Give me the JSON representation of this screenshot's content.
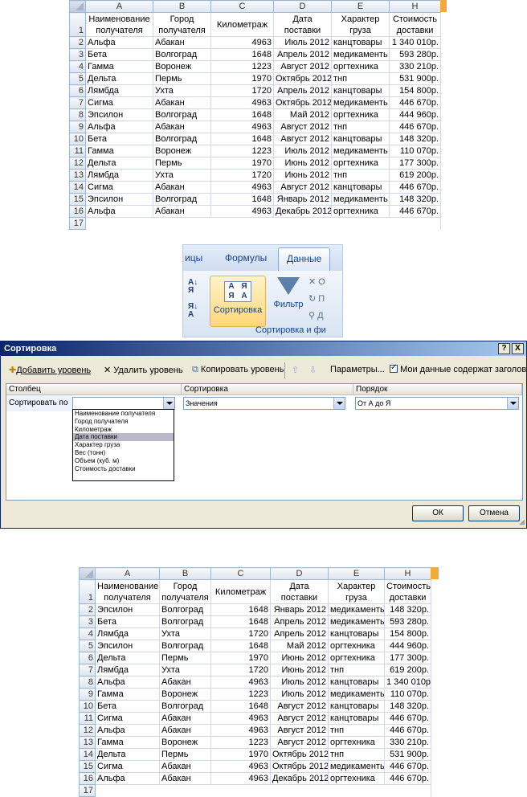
{
  "col_letters": [
    "A",
    "B",
    "C",
    "D",
    "E",
    "H"
  ],
  "headers": [
    "Наименование получателя",
    "Город получателя",
    "Километраж",
    "Дата поставки",
    "Характер груза",
    "Стоимость доставки"
  ],
  "table1": {
    "rows": [
      [
        "2",
        "Альфа",
        "Абакан",
        "4963",
        "Июль 2012",
        "канцтовары",
        "1 340 010р."
      ],
      [
        "3",
        "Бета",
        "Волгоград",
        "1648",
        "Апрель 2012",
        "медикаменть",
        "593 280р."
      ],
      [
        "4",
        "Гамма",
        "Воронеж",
        "1223",
        "Август 2012",
        "оргтехника",
        "330 210р."
      ],
      [
        "5",
        "Дельта",
        "Пермь",
        "1970",
        "Октябрь 2012",
        "тнп",
        "531 900р."
      ],
      [
        "6",
        "Лямбда",
        "Ухта",
        "1720",
        "Апрель 2012",
        "канцтовары",
        "154 800р."
      ],
      [
        "7",
        "Сигма",
        "Абакан",
        "4963",
        "Октябрь 2012",
        "медикаменть",
        "446 670р."
      ],
      [
        "8",
        "Эпсилон",
        "Волгоград",
        "1648",
        "Май 2012",
        "оргтехника",
        "444 960р."
      ],
      [
        "9",
        "Альфа",
        "Абакан",
        "4963",
        "Август 2012",
        "тнп",
        "446 670р."
      ],
      [
        "10",
        "Бета",
        "Волгоград",
        "1648",
        "Август 2012",
        "канцтовары",
        "148 320р."
      ],
      [
        "11",
        "Гамма",
        "Воронеж",
        "1223",
        "Июль 2012",
        "медикаменть",
        "110 070р."
      ],
      [
        "12",
        "Дельта",
        "Пермь",
        "1970",
        "Июнь 2012",
        "оргтехника",
        "177 300р."
      ],
      [
        "13",
        "Лямбда",
        "Ухта",
        "1720",
        "Июнь 2012",
        "тнп",
        "619 200р."
      ],
      [
        "14",
        "Сигма",
        "Абакан",
        "4963",
        "Август 2012",
        "канцтовары",
        "446 670р."
      ],
      [
        "15",
        "Эпсилон",
        "Волгоград",
        "1648",
        "Январь 2012",
        "медикаменть",
        "148 320р."
      ],
      [
        "16",
        "Альфа",
        "Абакан",
        "4963",
        "Декабрь 2012",
        "оргтехника",
        "446 670р."
      ]
    ]
  },
  "table2": {
    "rows": [
      [
        "2",
        "Эпсилон",
        "Волгоград",
        "1648",
        "Январь 2012",
        "медикаменть",
        "148 320р."
      ],
      [
        "3",
        "Бета",
        "Волгоград",
        "1648",
        "Апрель 2012",
        "медикаменть",
        "593 280р."
      ],
      [
        "4",
        "Лямбда",
        "Ухта",
        "1720",
        "Апрель 2012",
        "канцтовары",
        "154 800р."
      ],
      [
        "5",
        "Эпсилон",
        "Волгоград",
        "1648",
        "Май 2012",
        "оргтехника",
        "444 960р."
      ],
      [
        "6",
        "Дельта",
        "Пермь",
        "1970",
        "Июнь 2012",
        "оргтехника",
        "177 300р."
      ],
      [
        "7",
        "Лямбда",
        "Ухта",
        "1720",
        "Июнь 2012",
        "тнп",
        "619 200р."
      ],
      [
        "8",
        "Альфа",
        "Абакан",
        "4963",
        "Июль 2012",
        "канцтовары",
        "1 340 010р."
      ],
      [
        "9",
        "Гамма",
        "Воронеж",
        "1223",
        "Июль 2012",
        "медикаменть",
        "110 070р."
      ],
      [
        "10",
        "Бета",
        "Волгоград",
        "1648",
        "Август 2012",
        "канцтовары",
        "148 320р."
      ],
      [
        "11",
        "Сигма",
        "Абакан",
        "4963",
        "Август 2012",
        "канцтовары",
        "446 670р."
      ],
      [
        "12",
        "Альфа",
        "Абакан",
        "4963",
        "Август 2012",
        "тнп",
        "446 670р."
      ],
      [
        "13",
        "Гамма",
        "Воронеж",
        "1223",
        "Август 2012",
        "оргтехника",
        "330 210р."
      ],
      [
        "14",
        "Дельта",
        "Пермь",
        "1970",
        "Октябрь 2012",
        "тнп",
        "531 900р."
      ],
      [
        "15",
        "Сигма",
        "Абакан",
        "4963",
        "Октябрь 2012",
        "медикаменть",
        "446 670р."
      ],
      [
        "16",
        "Альфа",
        "Абакан",
        "4963",
        "Декабрь 2012",
        "оргтехника",
        "446 670р."
      ]
    ]
  },
  "ribbon": {
    "tab_left": "ицы",
    "tab_formulas": "Формулы",
    "tab_data": "Данные",
    "sort_label": "Сортировка",
    "filter_label": "Фильтр",
    "group_label": "Сортировка и фи",
    "mini1": "О",
    "mini2": "П",
    "mini3": "Д"
  },
  "dialog": {
    "title": "Сортировка",
    "help": "?",
    "close": "X",
    "add_level": "Добавить уровень",
    "delete_level": "Удалить уровень",
    "copy_level": "Копировать уровень",
    "params": "Параметры...",
    "headers_checkbox": "Мои данные содержат заголовки",
    "col_column": "Столбец",
    "col_sort": "Сортировка",
    "col_order": "Порядок",
    "sort_by": "Сортировать по",
    "sort_on_value": "Значения",
    "order_value": "От А до Я",
    "dropdown_items": [
      "Наименование получателя",
      "Город получателя",
      "Километраж",
      "Дата поставки",
      "Характер груза",
      "Вес (тонн)",
      "Объем (куб. м)",
      "Стоимость доставки"
    ],
    "ok": "ОК",
    "cancel": "Отмена"
  },
  "colors": {
    "accent": "#f5a93c",
    "titlebar": "#0a246a",
    "selection": "#b8b8c8"
  }
}
